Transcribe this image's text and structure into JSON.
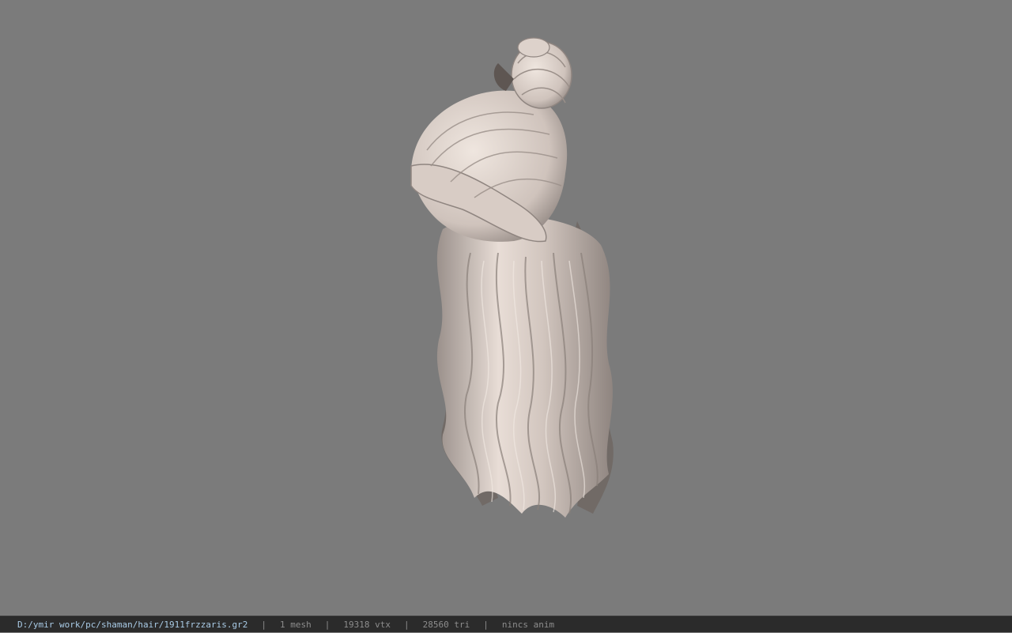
{
  "viewport": {
    "background_color": "#7b7b7b",
    "model_name": "hair-mesh-3d-model"
  },
  "statusbar": {
    "file_path": "D:/ymir work/pc/shaman/hair/1911frzzaris.gr2",
    "separator": "|",
    "mesh_count": "1 mesh",
    "vertex_count": "19318 vtx",
    "triangle_count": "28560 tri",
    "anim_status": "nincs anim"
  }
}
